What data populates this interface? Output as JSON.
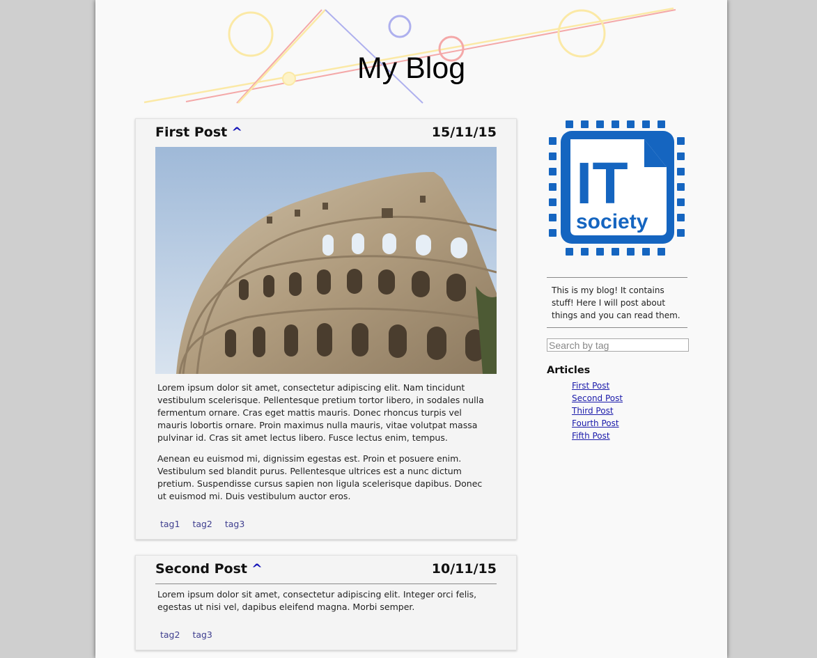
{
  "header": {
    "title": "My Blog"
  },
  "posts": [
    {
      "title": "First Post",
      "up_link": "^",
      "date": "15/11/15",
      "image_alt": "colosseum-photo",
      "paragraphs": [
        "Lorem ipsum dolor sit amet, consectetur adipiscing elit. Nam tincidunt vestibulum scelerisque. Pellentesque pretium tortor libero, in sodales nulla fermentum ornare. Cras eget mattis mauris. Donec rhoncus turpis vel mauris lobortis ornare. Proin maximus nulla mauris, vitae volutpat massa pulvinar id. Cras sit amet lectus libero. Fusce lectus enim, tempus.",
        "Aenean eu euismod mi, dignissim egestas est. Proin et posuere enim. Vestibulum sed blandit purus. Pellentesque ultrices est a nunc dictum pretium. Suspendisse cursus sapien non ligula scelerisque dapibus. Donec ut euismod mi. Duis vestibulum auctor eros."
      ],
      "tags": [
        "tag1",
        "tag2",
        "tag3"
      ]
    },
    {
      "title": "Second Post",
      "up_link": "^",
      "date": "10/11/15",
      "paragraphs": [
        "Lorem ipsum dolor sit amet, consectetur adipiscing elit. Integer orci felis, egestas ut nisi vel, dapibus eleifend magna. Morbi semper."
      ],
      "tags": [
        "tag2",
        "tag3"
      ]
    }
  ],
  "sidebar": {
    "logo": {
      "line1": "IT",
      "line2": "society",
      "color": "#1565c0"
    },
    "about": "This is my blog! It contains stuff! Here I will post about things and you can read them.",
    "search": {
      "placeholder": "Search by tag",
      "value": ""
    },
    "articles_title": "Articles",
    "articles": [
      "First Post",
      "Second Post",
      "Third Post",
      "Fourth Post",
      "Fifth Post"
    ]
  }
}
